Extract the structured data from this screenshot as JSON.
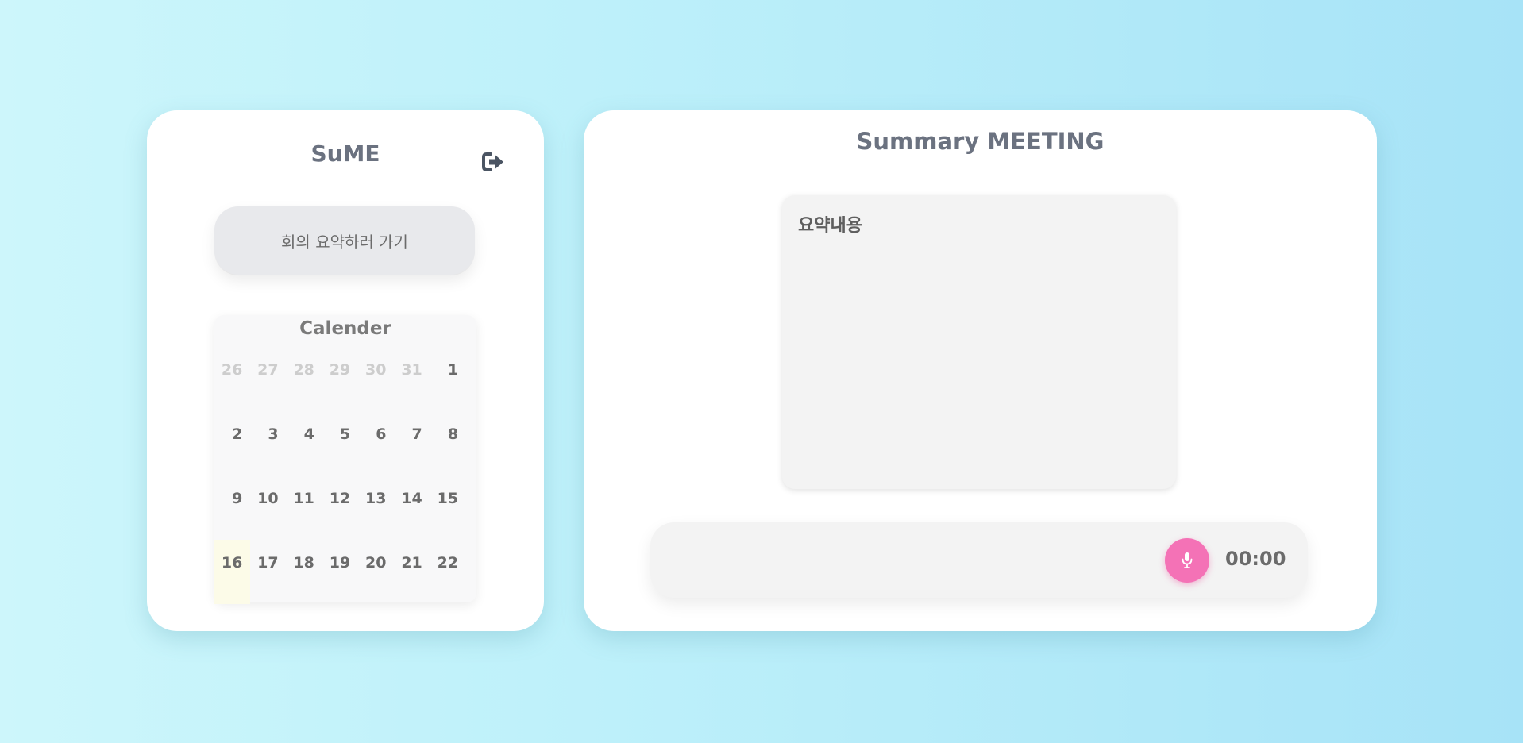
{
  "sidebar": {
    "app_title": "SuME",
    "logout_icon": "logout-icon",
    "summary_button_label": "회의 요약하러 가기",
    "calendar": {
      "title": "Calender",
      "days": [
        {
          "label": "26",
          "muted": true
        },
        {
          "label": "27",
          "muted": true
        },
        {
          "label": "28",
          "muted": true
        },
        {
          "label": "29",
          "muted": true
        },
        {
          "label": "30",
          "muted": true
        },
        {
          "label": "31",
          "muted": true
        },
        {
          "label": "1"
        },
        {
          "label": "2"
        },
        {
          "label": "3"
        },
        {
          "label": "4"
        },
        {
          "label": "5"
        },
        {
          "label": "6"
        },
        {
          "label": "7"
        },
        {
          "label": "8"
        },
        {
          "label": "9"
        },
        {
          "label": "10"
        },
        {
          "label": "11"
        },
        {
          "label": "12"
        },
        {
          "label": "13"
        },
        {
          "label": "14"
        },
        {
          "label": "15"
        },
        {
          "label": "16",
          "highlight": true
        },
        {
          "label": "17"
        },
        {
          "label": "18"
        },
        {
          "label": "19"
        },
        {
          "label": "20"
        },
        {
          "label": "21"
        },
        {
          "label": "22"
        }
      ]
    }
  },
  "main": {
    "title": "Summary MEETING",
    "summary_label": "요약내용",
    "recorder": {
      "mic_icon": "microphone-icon",
      "timer": "00:00"
    }
  },
  "colors": {
    "background_start": "#cdf6fb",
    "background_end": "#a7e3f7",
    "title_text": "#6b7280",
    "mic_button": "#f472b6",
    "highlight_day": "#fcfbe8"
  }
}
